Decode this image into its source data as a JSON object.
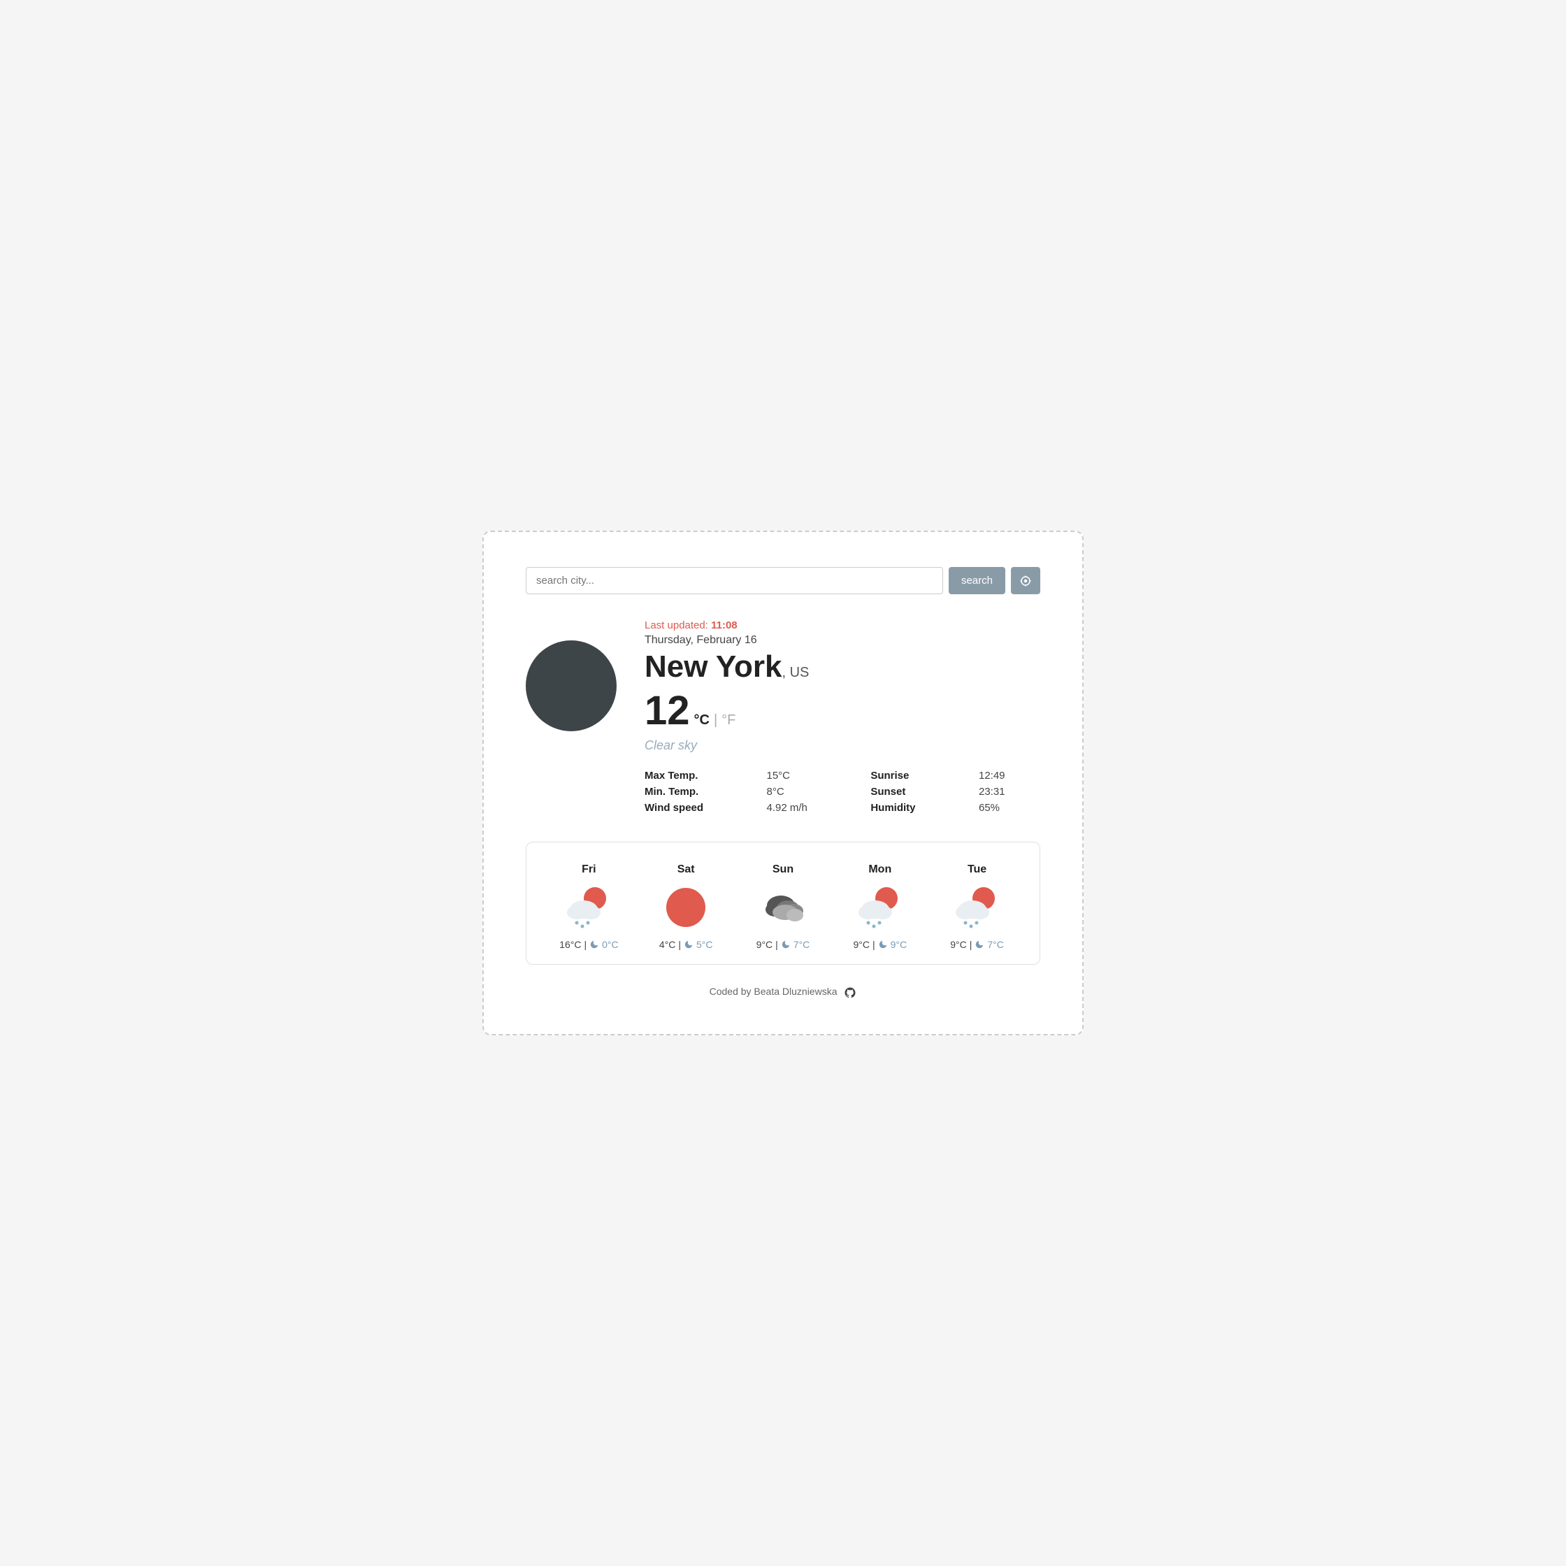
{
  "search": {
    "placeholder": "search city...",
    "button_label": "search",
    "location_icon": "◎"
  },
  "current": {
    "last_updated_label": "Last updated:",
    "last_updated_time": "11:08",
    "date": "Thursday, February 16",
    "city": "New York",
    "country": "US",
    "temperature": "12",
    "unit_celsius": "°C",
    "unit_sep": "|",
    "unit_fahrenheit": "°F",
    "description": "Clear sky",
    "max_temp_label": "Max Temp.",
    "max_temp_value": "15°C",
    "min_temp_label": "Min. Temp.",
    "min_temp_value": "8°C",
    "wind_speed_label": "Wind speed",
    "wind_speed_value": "4.92 m/h",
    "sunrise_label": "Sunrise",
    "sunrise_value": "12:49",
    "sunset_label": "Sunset",
    "sunset_value": "23:31",
    "humidity_label": "Humidity",
    "humidity_value": "65%"
  },
  "forecast": [
    {
      "day": "Fri",
      "icon_type": "rainy-sun",
      "high": "16°C",
      "low": "0°C"
    },
    {
      "day": "Sat",
      "icon_type": "sun",
      "high": "4°C",
      "low": "5°C"
    },
    {
      "day": "Sun",
      "icon_type": "cloudy",
      "high": "9°C",
      "low": "7°C"
    },
    {
      "day": "Mon",
      "icon_type": "rainy-sun",
      "high": "9°C",
      "low": "9°C"
    },
    {
      "day": "Tue",
      "icon_type": "rainy-sun",
      "high": "9°C",
      "low": "7°C"
    }
  ],
  "footer": {
    "text": "Coded by Beata Dluzniewska"
  }
}
